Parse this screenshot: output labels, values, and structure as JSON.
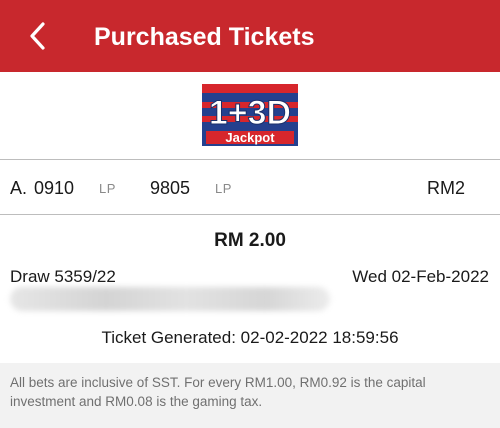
{
  "header": {
    "title": "Purchased Tickets",
    "back_icon": "chevron-left-icon",
    "color": "#c8282d"
  },
  "logo": {
    "main_text": "1+3D",
    "sub_text": "Jackpot",
    "colors": {
      "blue": "#24408e",
      "red": "#d7262c",
      "white": "#ffffff"
    }
  },
  "bet": {
    "prefix": "A.",
    "number_1": "0910",
    "type_1": "LP",
    "number_2": "9805",
    "type_2": "LP",
    "amount": "RM2"
  },
  "summary": {
    "total": "RM 2.00",
    "draw": "Draw 5359/22",
    "date": "Wed 02-Feb-2022",
    "generated": "Ticket Generated: 02-02-2022 18:59:56"
  },
  "footer": {
    "note": "All bets are inclusive of SST. For every RM1.00, RM0.92 is the capital investment and RM0.08 is the gaming tax."
  }
}
